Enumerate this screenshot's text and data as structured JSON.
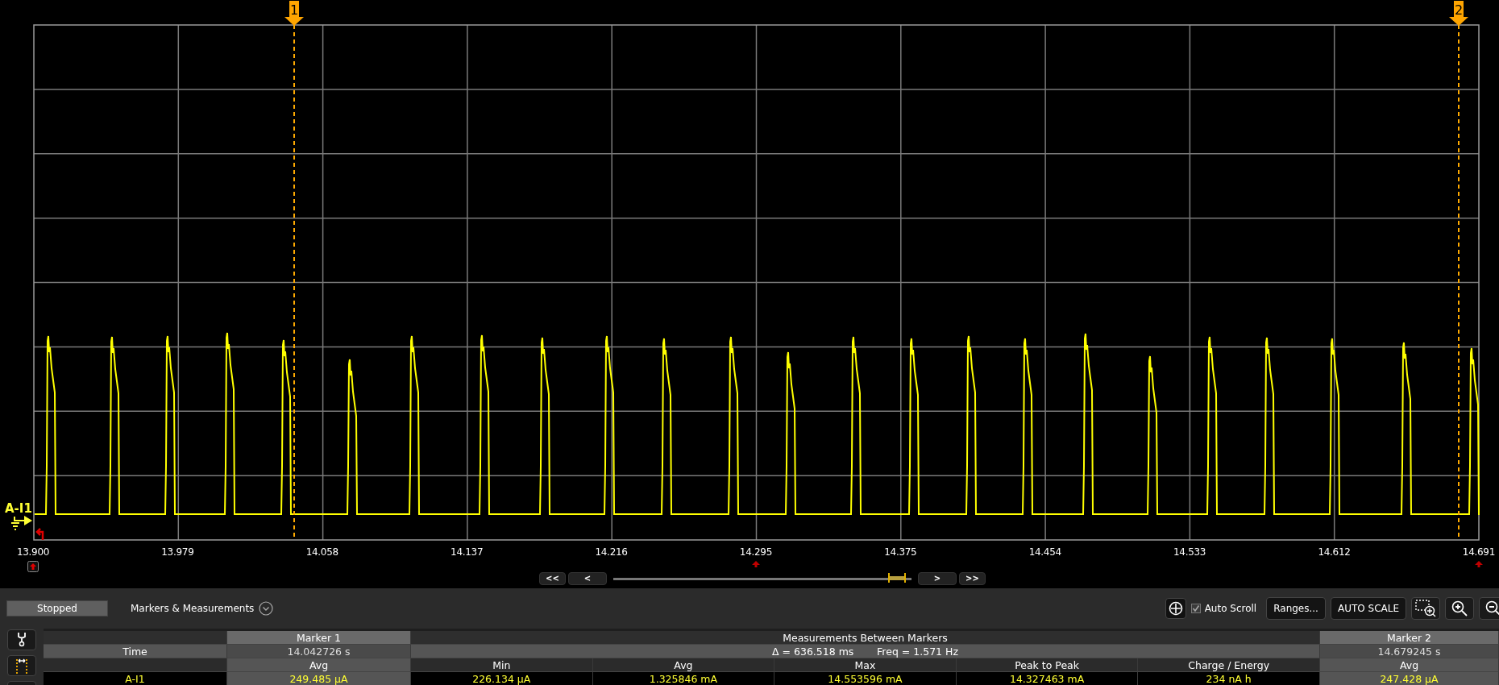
{
  "channel": {
    "label": "A-I1"
  },
  "markers": [
    {
      "label": "1"
    },
    {
      "label": "2"
    }
  ],
  "x_axis_labels": [
    "13.900",
    "13.979",
    "14.058",
    "14.137",
    "14.216",
    "14.295",
    "14.375",
    "14.454",
    "14.533",
    "14.612",
    "14.691"
  ],
  "navigation": {
    "buttons": [
      "<<",
      "<",
      ">",
      ">>"
    ],
    "slider": {
      "level": 0.95
    }
  },
  "status": "Stopped",
  "panel_title": "Markers & Measurements",
  "toolbar": {
    "auto_scroll": {
      "label": "Auto Scroll",
      "checked": true
    },
    "buttons": [
      "Ranges...",
      "AUTO SCALE"
    ]
  },
  "table": {
    "header": {
      "marker_1": "Marker 1",
      "between": "Measurements Between Markers",
      "marker_2": "Marker 2"
    },
    "time_row": {
      "label": "Time",
      "marker_1": "14.042726 s",
      "delta": "Δ = 636.518 ms",
      "freq": "Freq = 1.571 Hz",
      "marker_2": "14.679245 s"
    },
    "columns": [
      "Avg",
      "Min",
      "Avg",
      "Max",
      "Peak to Peak",
      "Charge / Energy",
      "Avg"
    ],
    "rows": [
      {
        "label": "A-I1",
        "values": [
          "249.485 µA",
          "226.134 µA",
          "1.325846 mA",
          "14.553596 mA",
          "14.327463 mA",
          "234 nA h",
          "247.428 µA"
        ]
      }
    ]
  }
}
